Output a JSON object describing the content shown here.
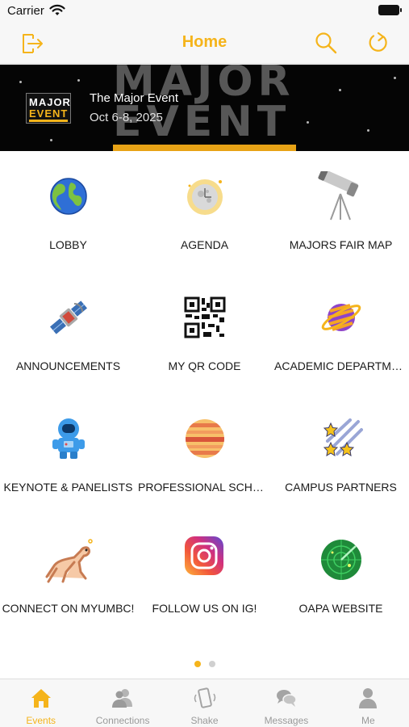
{
  "status_bar": {
    "carrier": "Carrier"
  },
  "nav": {
    "title": "Home"
  },
  "banner": {
    "bg_text_line1": "MAJOR",
    "bg_text_line2": "EVENT",
    "logo_line1": "MAJOR",
    "logo_line2": "EVENT",
    "event_name": "The Major Event",
    "event_date": "Oct 6-8, 2025"
  },
  "tiles": [
    {
      "label": "LOBBY",
      "icon": "globe-icon"
    },
    {
      "label": "AGENDA",
      "icon": "moon-clock-icon"
    },
    {
      "label": "MAJORS FAIR MAP",
      "icon": "telescope-icon"
    },
    {
      "label": "ANNOUNCEMENTS",
      "icon": "satellite-icon"
    },
    {
      "label": "MY QR CODE",
      "icon": "qr-code-icon"
    },
    {
      "label": "ACADEMIC DEPARTME...",
      "icon": "ringed-planet-icon"
    },
    {
      "label": "KEYNOTE & PANELISTS",
      "icon": "astronaut-icon"
    },
    {
      "label": "PROFESSIONAL SCHOO...",
      "icon": "striped-planet-icon"
    },
    {
      "label": "CAMPUS PARTNERS",
      "icon": "shooting-stars-icon"
    },
    {
      "label": "CONNECT ON MYUMBC!",
      "icon": "dog-icon"
    },
    {
      "label": "FOLLOW US ON IG!",
      "icon": "instagram-icon"
    },
    {
      "label": "OAPA WEBSITE",
      "icon": "radar-icon"
    }
  ],
  "pager": {
    "pages": 2,
    "current": 1
  },
  "tabs": [
    {
      "label": "Events",
      "icon": "house-icon",
      "active": true
    },
    {
      "label": "Connections",
      "icon": "people-icon",
      "active": false
    },
    {
      "label": "Shake",
      "icon": "shake-phone-icon",
      "active": false
    },
    {
      "label": "Messages",
      "icon": "chat-bubbles-icon",
      "active": false
    },
    {
      "label": "Me",
      "icon": "person-icon",
      "active": false
    }
  ],
  "colors": {
    "accent": "#f5b41b",
    "inactive": "#9a9a9a"
  }
}
